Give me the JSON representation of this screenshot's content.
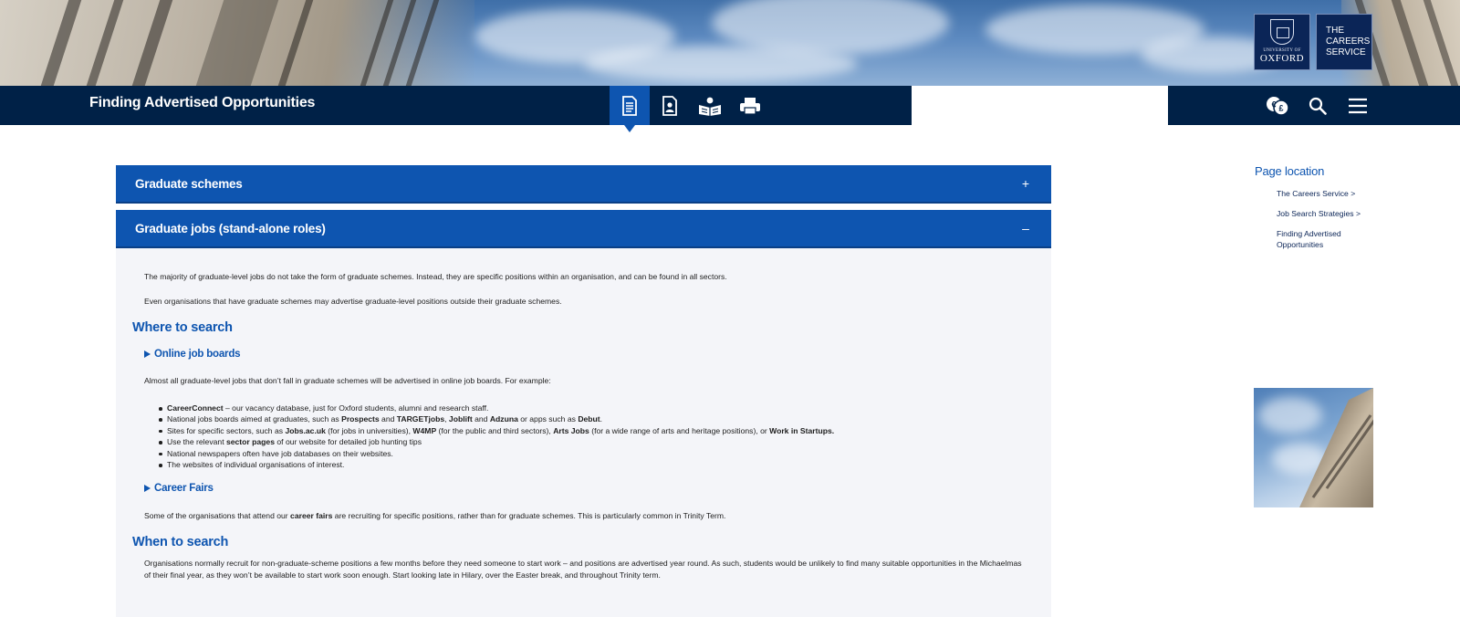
{
  "banner": {
    "logo_oxford_line1": "UNIVERSITY OF",
    "logo_oxford_line2": "OXFORD",
    "logo_careers_lines": [
      "THE",
      "CAREERS",
      "SERVICE"
    ]
  },
  "navbar": {
    "page_title": "Finding Advertised Opportunities",
    "page_icons": [
      "document-icon",
      "profile-card-icon",
      "reading-person-icon",
      "printer-icon"
    ],
    "tool_icons": [
      "translate-icon",
      "search-icon",
      "menu-icon"
    ]
  },
  "accordions": [
    {
      "title": "Graduate schemes",
      "toggle": "+",
      "expanded": false
    },
    {
      "title": "Graduate jobs (stand-alone roles)",
      "toggle": "–",
      "expanded": true
    }
  ],
  "content": {
    "intro_p1": "The majority of graduate-level jobs do not take the form of graduate schemes. Instead, they are specific positions within an organisation, and can be found in all sectors.",
    "intro_p2": "Even organisations that have graduate schemes may advertise graduate-level positions outside their graduate schemes.",
    "where_heading": "Where to search",
    "online_heading": "Online job boards",
    "online_intro": "Almost all graduate-level jobs that don’t fall in graduate schemes will be advertised in online job boards. For example:",
    "bullets": {
      "b1_bold": "CareerConnect",
      "b1_rest": " – our vacancy database, just for Oxford students, alumni and research staff.",
      "b2_pre": "National jobs boards aimed at graduates, such as ",
      "b2_prospects": "Prospects",
      "b2_and1": " and ",
      "b2_target": "TARGETjobs",
      "b2_comma": ", ",
      "b2_joblift": "Joblift",
      "b2_and2": " and ",
      "b2_adzuna": "Adzuna",
      "b2_apps": " or apps such as ",
      "b2_debut": "Debut",
      "b2_end": ".",
      "b3_pre": "Sites for specific sectors, such as ",
      "b3_jobsac": "Jobs.ac.uk",
      "b3_mid1": " (for jobs in universities), ",
      "b3_w4mp": "W4MP",
      "b3_mid2": " (for the public and third sectors), ",
      "b3_arts": "Arts Jobs",
      "b3_mid3": " (for a wide range of arts and heritage positions), or ",
      "b3_startups": "Work in Startups.",
      "b4_pre": "Use the relevant ",
      "b4_bold": "sector pages",
      "b4_rest": " of our website for detailed job hunting tips",
      "b5": "National newspapers often have job databases on their websites.",
      "b6": "The websites of individual organisations of interest."
    },
    "fairs_heading": "Career Fairs",
    "fairs_pre": "Some of the organisations that attend our ",
    "fairs_bold": "career fairs",
    "fairs_rest": " are recruiting for specific positions, rather than for graduate schemes. This is particularly common in Trinity Term.",
    "when_heading": "When to search",
    "when_p": "Organisations normally recruit for non-graduate-scheme positions a few months before they need someone to start work – and positions are advertised year round. As such, students would be unlikely to find many suitable opportunities in the Michaelmas of their final year, as they won’t be available to start work soon enough. Start looking late in Hilary, over the Easter break, and throughout Trinity term."
  },
  "sidebar": {
    "heading": "Page location",
    "items": [
      {
        "label": "The Careers Service >"
      },
      {
        "label": "Job Search Strategies >"
      },
      {
        "label": "Finding Advertised Opportunities"
      }
    ]
  },
  "colors": {
    "navy": "#002147",
    "accent_blue": "#0e55b0",
    "panel_bg": "#f4f5f9"
  }
}
